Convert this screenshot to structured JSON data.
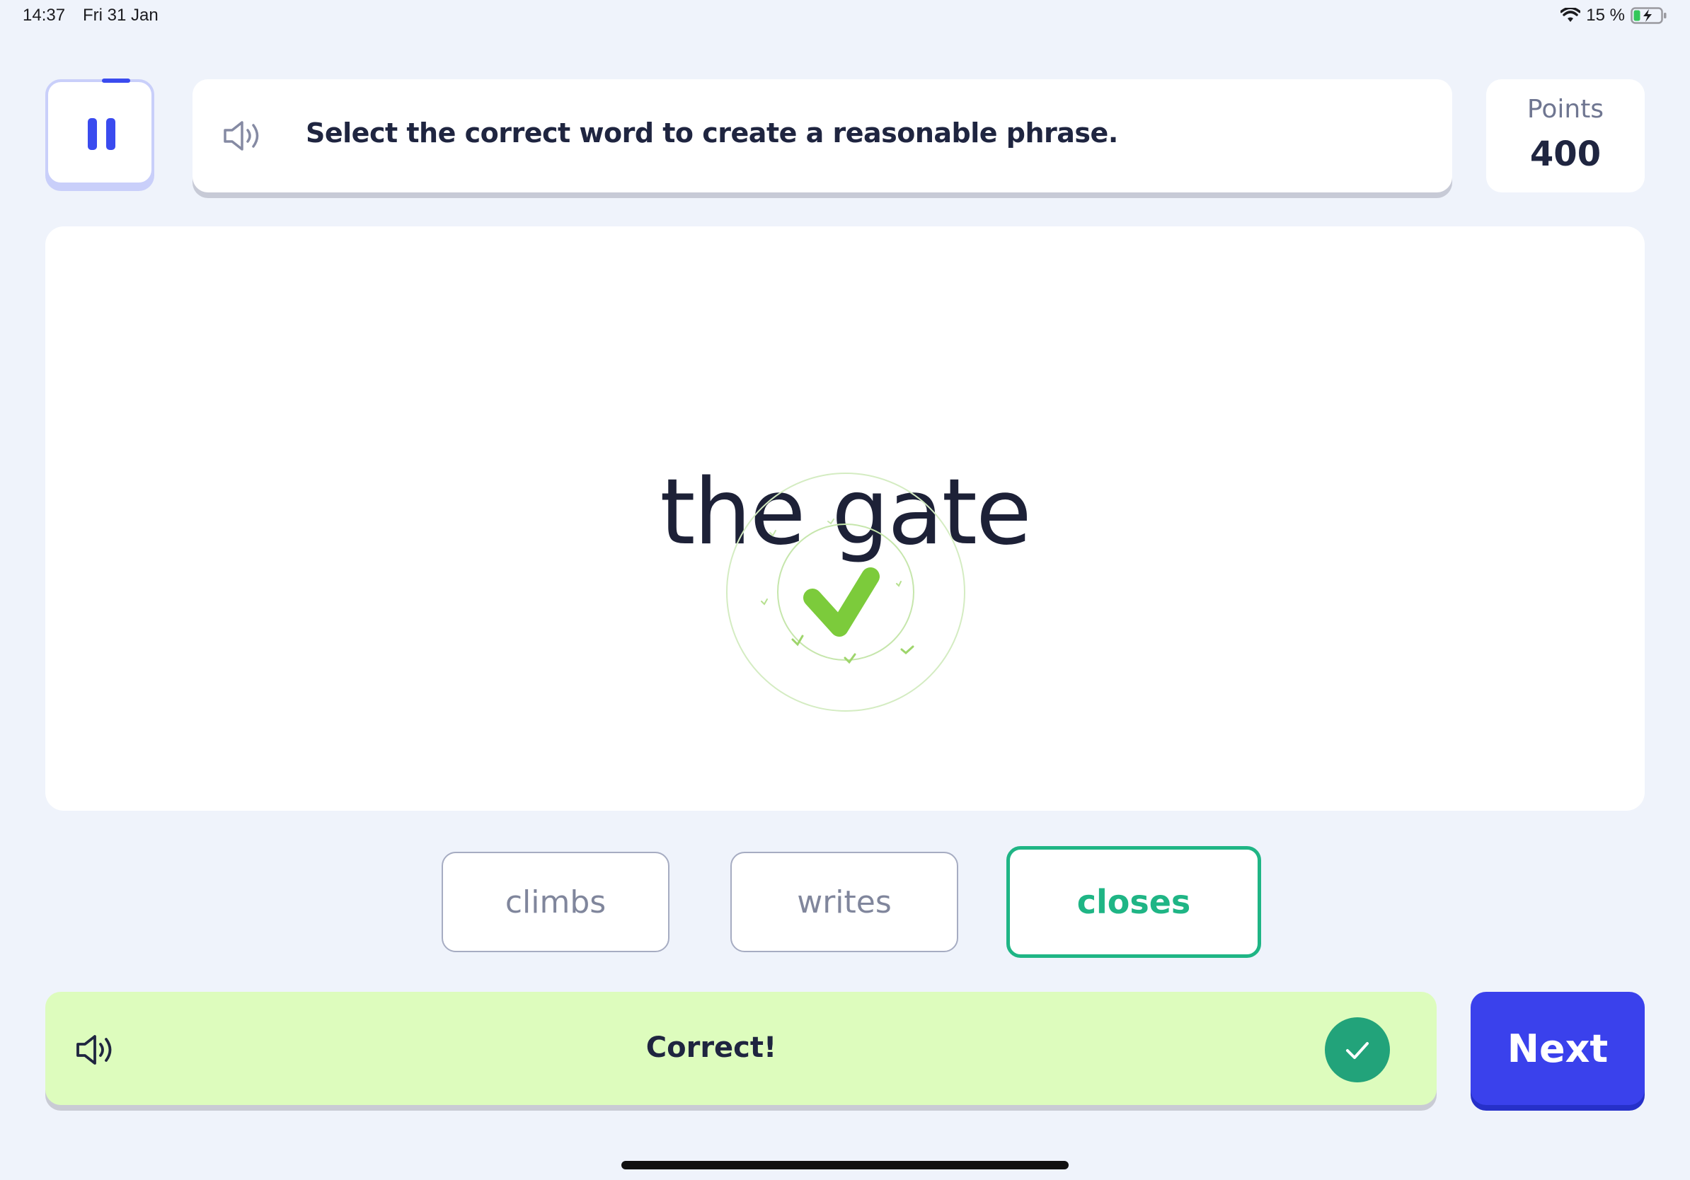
{
  "status_bar": {
    "time": "14:37",
    "date": "Fri 31 Jan",
    "battery": "15 %"
  },
  "header": {
    "instruction": "Select the correct word to create a reasonable phrase.",
    "points_label": "Points",
    "points_value": "400"
  },
  "question": {
    "phrase": "the gate"
  },
  "choices": [
    {
      "label": "climbs",
      "state": "default"
    },
    {
      "label": "writes",
      "state": "default"
    },
    {
      "label": "closes",
      "state": "correct"
    }
  ],
  "feedback": {
    "text": "Correct!"
  },
  "actions": {
    "next_label": "Next"
  },
  "colors": {
    "accent": "#3a41ec",
    "correct": "#1fb585",
    "feedback_bg": "#ddfcbd",
    "check_green": "#7ccb3b"
  }
}
